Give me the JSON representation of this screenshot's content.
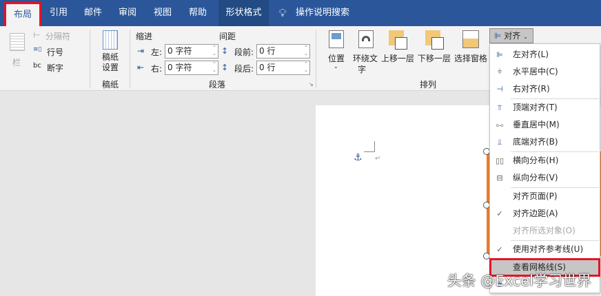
{
  "tabs": [
    {
      "label": "布局",
      "selected": true
    },
    {
      "label": "引用"
    },
    {
      "label": "邮件"
    },
    {
      "label": "审阅"
    },
    {
      "label": "视图"
    },
    {
      "label": "帮助"
    },
    {
      "label": "形状格式",
      "contextual": true
    }
  ],
  "tell_me": "操作说明搜索",
  "page_setup": {
    "columns": "栏",
    "breaks": "分隔符",
    "line_numbers": "行号",
    "hyphenation": "断字"
  },
  "manuscript": {
    "button": "稿纸\n设置",
    "group": "稿纸"
  },
  "paragraph": {
    "indent_label": "缩进",
    "spacing_label": "间距",
    "left_label": "左:",
    "right_label": "右:",
    "before_label": "段前:",
    "after_label": "段后:",
    "left_value": "0 字符",
    "right_value": "0 字符",
    "before_value": "0 行",
    "after_value": "0 行",
    "group": "段落"
  },
  "arrange": {
    "position": "位置",
    "wrap_text_1": "环绕文",
    "wrap_text_2": "字",
    "bring_forward": "上移一层",
    "send_backward": "下移一层",
    "selection_pane": "选择窗格",
    "align": "对齐",
    "group": "排列"
  },
  "align_menu": [
    {
      "label": "左对齐(L)",
      "icon": "align-left-icon"
    },
    {
      "label": "水平居中(C)",
      "icon": "align-center-icon"
    },
    {
      "label": "右对齐(R)",
      "icon": "align-right-icon"
    },
    {
      "label": "顶端对齐(T)",
      "icon": "align-top-icon"
    },
    {
      "label": "垂直居中(M)",
      "icon": "align-middle-icon"
    },
    {
      "label": "底端对齐(B)",
      "icon": "align-bottom-icon"
    },
    {
      "label": "横向分布(H)",
      "icon": "distribute-horizontal-icon"
    },
    {
      "label": "纵向分布(V)",
      "icon": "distribute-vertical-icon"
    },
    {
      "label": "对齐页面(P)"
    },
    {
      "label": "对齐边距(A)",
      "checked": true
    },
    {
      "label": "对齐所选对象(O)",
      "disabled": true
    },
    {
      "label": "使用对齐参考线(U)",
      "checked": true
    },
    {
      "label": "查看网格线(S)",
      "highlighted": true
    }
  ],
  "watermark": "头条 @Excel学习世界"
}
